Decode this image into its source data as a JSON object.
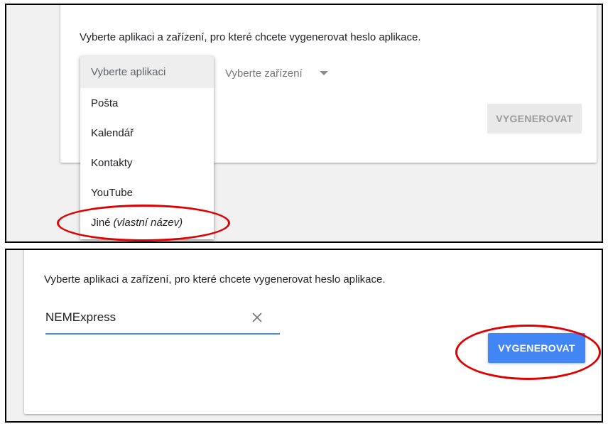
{
  "top_panel": {
    "description": "Vyberte aplikaci a zařízení, pro které chcete vygenerovat heslo aplikace.",
    "app_dropdown": {
      "selected_placeholder": "Vyberte aplikaci",
      "options": [
        "Pošta",
        "Kalendář",
        "Kontakty",
        "YouTube"
      ],
      "other_option": {
        "label": "Jiné",
        "hint": "(vlastní název)"
      }
    },
    "device_select": {
      "placeholder": "Vyberte zařízení",
      "icon": "caret-down-icon"
    },
    "generate_button": {
      "label": "VYGENEROVAT",
      "state": "disabled"
    },
    "highlight_color": "#e00000"
  },
  "bottom_panel": {
    "description": "Vyberte aplikaci a zařízení, pro které chcete vygenerovat heslo aplikace.",
    "custom_name_input": {
      "value": "NEMExpress",
      "clear_icon": "close-icon"
    },
    "generate_button": {
      "label": "VYGENEROVAT",
      "state": "enabled",
      "color": "#4285f4"
    },
    "highlight_color": "#e00000"
  }
}
